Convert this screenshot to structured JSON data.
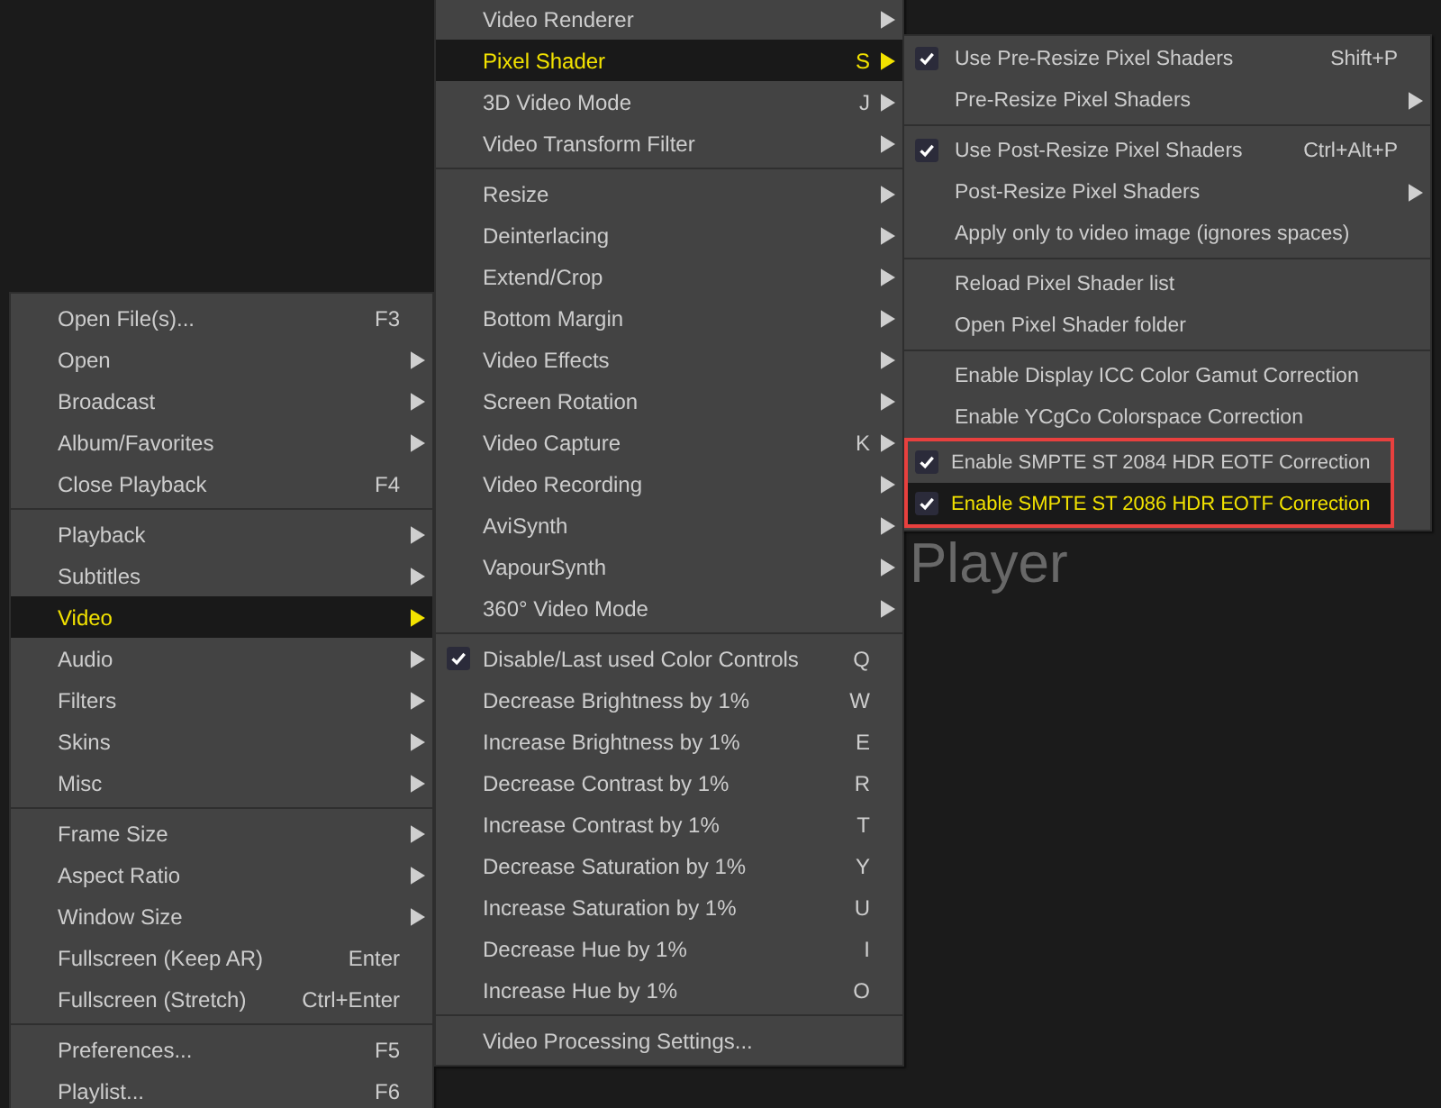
{
  "background_title": "Player",
  "menus": [
    {
      "items": [
        {
          "kind": "item",
          "label": "Open File(s)...",
          "shortcut": "F3",
          "submenu": false,
          "checked": false,
          "selected": false
        },
        {
          "kind": "item",
          "label": "Open",
          "submenu": true,
          "checked": false,
          "selected": false
        },
        {
          "kind": "item",
          "label": "Broadcast",
          "submenu": true,
          "checked": false,
          "selected": false
        },
        {
          "kind": "item",
          "label": "Album/Favorites",
          "submenu": true,
          "checked": false,
          "selected": false
        },
        {
          "kind": "item",
          "label": "Close Playback",
          "shortcut": "F4",
          "submenu": false,
          "checked": false,
          "selected": false
        },
        {
          "kind": "separator"
        },
        {
          "kind": "item",
          "label": "Playback",
          "submenu": true,
          "checked": false,
          "selected": false
        },
        {
          "kind": "item",
          "label": "Subtitles",
          "submenu": true,
          "checked": false,
          "selected": false
        },
        {
          "kind": "item",
          "label": "Video",
          "submenu": true,
          "checked": false,
          "selected": true
        },
        {
          "kind": "item",
          "label": "Audio",
          "submenu": true,
          "checked": false,
          "selected": false
        },
        {
          "kind": "item",
          "label": "Filters",
          "submenu": true,
          "checked": false,
          "selected": false
        },
        {
          "kind": "item",
          "label": "Skins",
          "submenu": true,
          "checked": false,
          "selected": false
        },
        {
          "kind": "item",
          "label": "Misc",
          "submenu": true,
          "checked": false,
          "selected": false
        },
        {
          "kind": "separator"
        },
        {
          "kind": "item",
          "label": "Frame Size",
          "submenu": true,
          "checked": false,
          "selected": false
        },
        {
          "kind": "item",
          "label": "Aspect Ratio",
          "submenu": true,
          "checked": false,
          "selected": false
        },
        {
          "kind": "item",
          "label": "Window Size",
          "submenu": true,
          "checked": false,
          "selected": false
        },
        {
          "kind": "item",
          "label": "Fullscreen (Keep AR)",
          "shortcut": "Enter",
          "submenu": false,
          "checked": false,
          "selected": false
        },
        {
          "kind": "item",
          "label": "Fullscreen (Stretch)",
          "shortcut": "Ctrl+Enter",
          "submenu": false,
          "checked": false,
          "selected": false
        },
        {
          "kind": "separator"
        },
        {
          "kind": "item",
          "label": "Preferences...",
          "shortcut": "F5",
          "submenu": false,
          "checked": false,
          "selected": false
        },
        {
          "kind": "item",
          "label": "Playlist...",
          "shortcut": "F6",
          "submenu": false,
          "checked": false,
          "selected": false
        }
      ]
    },
    {
      "items": [
        {
          "kind": "item",
          "label": "Video Renderer",
          "submenu": true,
          "checked": false,
          "selected": false
        },
        {
          "kind": "item",
          "label": "Pixel Shader",
          "shortcut": "S",
          "submenu": true,
          "checked": false,
          "selected": true
        },
        {
          "kind": "item",
          "label": "3D Video Mode",
          "shortcut": "J",
          "submenu": true,
          "checked": false,
          "selected": false
        },
        {
          "kind": "item",
          "label": "Video Transform Filter",
          "submenu": true,
          "checked": false,
          "selected": false
        },
        {
          "kind": "separator"
        },
        {
          "kind": "item",
          "label": "Resize",
          "submenu": true,
          "checked": false,
          "selected": false
        },
        {
          "kind": "item",
          "label": "Deinterlacing",
          "submenu": true,
          "checked": false,
          "selected": false
        },
        {
          "kind": "item",
          "label": "Extend/Crop",
          "submenu": true,
          "checked": false,
          "selected": false
        },
        {
          "kind": "item",
          "label": "Bottom Margin",
          "submenu": true,
          "checked": false,
          "selected": false
        },
        {
          "kind": "item",
          "label": "Video Effects",
          "submenu": true,
          "checked": false,
          "selected": false
        },
        {
          "kind": "item",
          "label": "Screen Rotation",
          "submenu": true,
          "checked": false,
          "selected": false
        },
        {
          "kind": "item",
          "label": "Video Capture",
          "shortcut": "K",
          "submenu": true,
          "checked": false,
          "selected": false
        },
        {
          "kind": "item",
          "label": "Video Recording",
          "submenu": true,
          "checked": false,
          "selected": false
        },
        {
          "kind": "item",
          "label": "AviSynth",
          "submenu": true,
          "checked": false,
          "selected": false
        },
        {
          "kind": "item",
          "label": "VapourSynth",
          "submenu": true,
          "checked": false,
          "selected": false
        },
        {
          "kind": "item",
          "label": "360° Video Mode",
          "submenu": true,
          "checked": false,
          "selected": false
        },
        {
          "kind": "separator"
        },
        {
          "kind": "item",
          "label": "Disable/Last used Color Controls",
          "shortcut": "Q",
          "submenu": false,
          "checked": true,
          "selected": false
        },
        {
          "kind": "item",
          "label": "Decrease Brightness by 1%",
          "shortcut": "W",
          "submenu": false,
          "checked": false,
          "selected": false
        },
        {
          "kind": "item",
          "label": "Increase Brightness by 1%",
          "shortcut": "E",
          "submenu": false,
          "checked": false,
          "selected": false
        },
        {
          "kind": "item",
          "label": "Decrease Contrast by 1%",
          "shortcut": "R",
          "submenu": false,
          "checked": false,
          "selected": false
        },
        {
          "kind": "item",
          "label": "Increase Contrast by 1%",
          "shortcut": "T",
          "submenu": false,
          "checked": false,
          "selected": false
        },
        {
          "kind": "item",
          "label": "Decrease Saturation by 1%",
          "shortcut": "Y",
          "submenu": false,
          "checked": false,
          "selected": false
        },
        {
          "kind": "item",
          "label": "Increase Saturation by 1%",
          "shortcut": "U",
          "submenu": false,
          "checked": false,
          "selected": false
        },
        {
          "kind": "item",
          "label": "Decrease Hue by 1%",
          "shortcut": "I",
          "submenu": false,
          "checked": false,
          "selected": false
        },
        {
          "kind": "item",
          "label": "Increase Hue by 1%",
          "shortcut": "O",
          "submenu": false,
          "checked": false,
          "selected": false
        },
        {
          "kind": "separator"
        },
        {
          "kind": "item",
          "label": "Video Processing Settings...",
          "submenu": false,
          "checked": false,
          "selected": false
        }
      ]
    },
    {
      "items": [
        {
          "kind": "item",
          "label": "Use Pre-Resize Pixel Shaders",
          "shortcut": "Shift+P",
          "submenu": false,
          "checked": true,
          "selected": false,
          "outlined": false
        },
        {
          "kind": "item",
          "label": "Pre-Resize Pixel Shaders",
          "submenu": true,
          "checked": false,
          "selected": false,
          "outlined": false
        },
        {
          "kind": "separator"
        },
        {
          "kind": "item",
          "label": "Use Post-Resize Pixel Shaders",
          "shortcut": "Ctrl+Alt+P",
          "submenu": false,
          "checked": true,
          "selected": false,
          "outlined": false
        },
        {
          "kind": "item",
          "label": "Post-Resize Pixel Shaders",
          "submenu": true,
          "checked": false,
          "selected": false,
          "outlined": false
        },
        {
          "kind": "item",
          "label": "Apply only to video image (ignores spaces)",
          "submenu": false,
          "checked": false,
          "selected": false,
          "outlined": false
        },
        {
          "kind": "separator"
        },
        {
          "kind": "item",
          "label": "Reload Pixel Shader list",
          "submenu": false,
          "checked": false,
          "selected": false,
          "outlined": false
        },
        {
          "kind": "item",
          "label": "Open Pixel Shader folder",
          "submenu": false,
          "checked": false,
          "selected": false,
          "outlined": false
        },
        {
          "kind": "separator"
        },
        {
          "kind": "item",
          "label": "Enable Display ICC Color Gamut Correction",
          "submenu": false,
          "checked": false,
          "selected": false,
          "outlined": false
        },
        {
          "kind": "item",
          "label": "Enable YCgCo Colorspace Correction",
          "submenu": false,
          "checked": false,
          "selected": false,
          "outlined": false
        },
        {
          "kind": "item",
          "label": "Enable SMPTE ST 2084 HDR EOTF Correction",
          "submenu": false,
          "checked": true,
          "selected": false,
          "outlined": true
        },
        {
          "kind": "item",
          "label": "Enable SMPTE ST 2086 HDR EOTF Correction",
          "submenu": false,
          "checked": true,
          "selected": true,
          "outlined": true
        }
      ]
    }
  ]
}
